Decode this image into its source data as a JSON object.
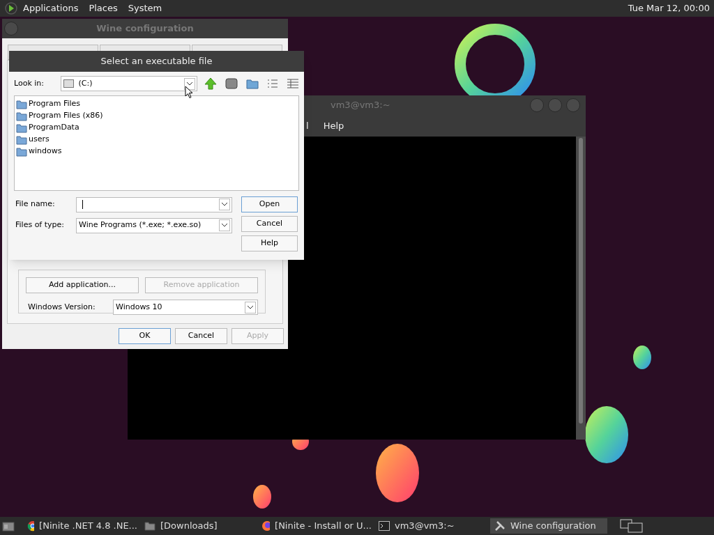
{
  "top_panel": {
    "menus": [
      "Applications",
      "Places",
      "System"
    ],
    "clock": "Tue Mar 12, 00:00"
  },
  "terminal": {
    "title": "vm3@vm3:~",
    "menu_items": [
      "l",
      "Help"
    ]
  },
  "wine_config": {
    "title": "Wine configuration",
    "tabs": [
      {
        "selected": false
      },
      {
        "selected": false
      },
      {
        "selected": false
      }
    ],
    "buttons": [
      {
        "label": "Add application...",
        "disabled": false
      },
      {
        "label": "Remove application",
        "disabled": true
      }
    ],
    "windows_version": {
      "label": "Windows Version:",
      "value": "Windows 10"
    },
    "footer_buttons": [
      {
        "label": "OK",
        "disabled": false,
        "default": true
      },
      {
        "label": "Cancel",
        "disabled": false,
        "default": false
      },
      {
        "label": "Apply",
        "disabled": true,
        "default": false
      }
    ]
  },
  "file_dialog": {
    "title": "Select an executable file",
    "look_in": {
      "label": "Look in:",
      "value": "(C:)"
    },
    "files": [
      "Program Files",
      "Program Files (x86)",
      "ProgramData",
      "users",
      "windows"
    ],
    "file_name": {
      "label": "File name:"
    },
    "file_type": {
      "label": "Files of type:",
      "value": "Wine Programs (*.exe; *.exe.so)"
    },
    "buttons": [
      {
        "label": "Open",
        "default": true
      },
      {
        "label": "Cancel",
        "default": false
      },
      {
        "label": "Help",
        "default": false
      }
    ]
  },
  "taskbar": {
    "items": [
      {
        "kind": "browser",
        "label": "[Ninite .NET 4.8 .NE...",
        "selected": false
      },
      {
        "kind": "folder",
        "label": "[Downloads]",
        "selected": false
      },
      {
        "kind": "firefox",
        "label": "[Ninite - Install or U...",
        "selected": false
      },
      {
        "kind": "terminal",
        "label": "vm3@vm3:~",
        "selected": false
      },
      {
        "kind": "tools",
        "label": "Wine configuration",
        "selected": true
      }
    ]
  }
}
